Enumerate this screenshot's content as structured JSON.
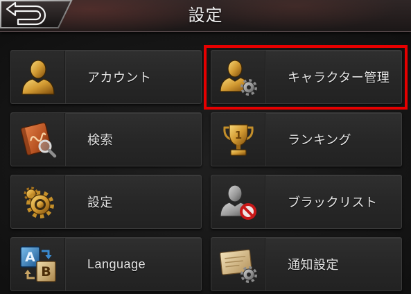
{
  "header": {
    "title": "設定",
    "back_button": {
      "icon": "back-arrow-icon"
    }
  },
  "menu": {
    "items": [
      {
        "label": "アカウント",
        "icon": "account-silhouette-icon"
      },
      {
        "label": "キャラクター管理",
        "icon": "character-settings-icon",
        "highlighted": true
      },
      {
        "label": "検索",
        "icon": "search-book-icon"
      },
      {
        "label": "ランキング",
        "icon": "trophy-icon",
        "icon_text": "1"
      },
      {
        "label": "設定",
        "icon": "gear-icon"
      },
      {
        "label": "ブラックリスト",
        "icon": "blacklist-icon"
      },
      {
        "label": "Language",
        "icon": "language-ab-icon",
        "icon_letters": [
          "A",
          "B"
        ]
      },
      {
        "label": "通知設定",
        "icon": "notification-settings-icon"
      }
    ]
  },
  "colors": {
    "highlight": "#e60000",
    "label_text": "#e6e6e6",
    "icon_gold": "#d29a32",
    "panel_background": "#272727",
    "screen_background": "#151515"
  }
}
